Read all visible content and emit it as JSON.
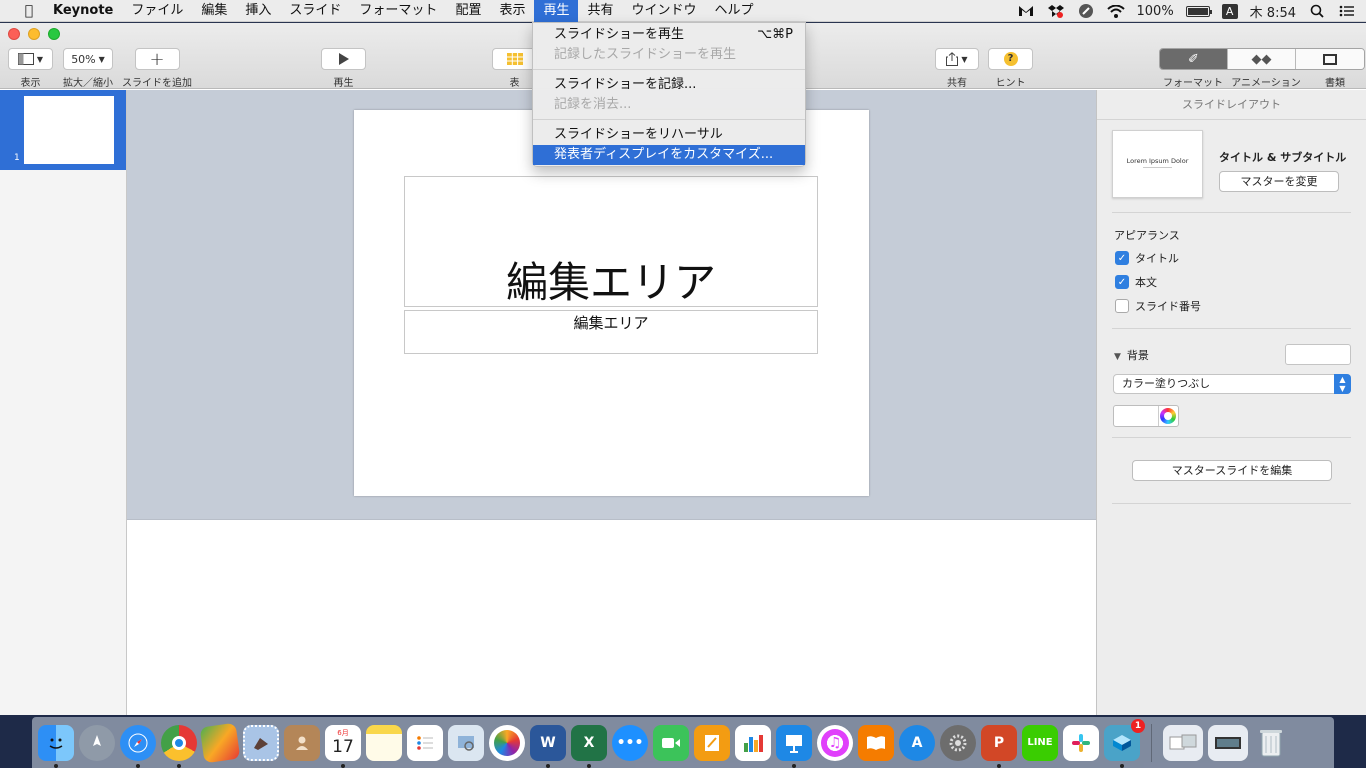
{
  "menubar": {
    "app": "Keynote",
    "items": [
      "ファイル",
      "編集",
      "挿入",
      "スライド",
      "フォーマット",
      "配置",
      "表示",
      "再生",
      "共有",
      "ウインドウ",
      "ヘルプ"
    ],
    "active": "再生",
    "battery": "100%",
    "ime": "A",
    "clock": "木 8:54"
  },
  "toolbar": {
    "view_label": "表示",
    "zoom_value": "50%",
    "zoom_label": "拡大／縮小",
    "add_slide_label": "スライドを追加",
    "play_label": "再生",
    "table_label": "表",
    "share_label": "共有",
    "hint_label": "ヒント",
    "format_label": "フォーマット",
    "animate_label": "アニメーション",
    "document_label": "書類"
  },
  "navigator": {
    "slide_number": "1"
  },
  "slide": {
    "title": "編集エリア",
    "subtitle": "編集エリア"
  },
  "inspector": {
    "header": "スライドレイアウト",
    "layout_preview_title": "Lorem Ipsum Dolor",
    "layout_name": "タイトル & サブタイトル",
    "change_master": "マスターを変更",
    "appearance": "アピアランス",
    "title_check": "タイトル",
    "body_check": "本文",
    "slide_number_check": "スライド番号",
    "background": "背景",
    "fill_type": "カラー塗りつぶし",
    "edit_master": "マスタースライドを編集"
  },
  "play_menu": {
    "play": "スライドショーを再生",
    "play_shortcut": "⌥⌘P",
    "play_recorded": "記録したスライドショーを再生",
    "record": "スライドショーを記録...",
    "clear_recording": "記録を消去...",
    "rehearse": "スライドショーをリハーサル",
    "customize_presenter": "発表者ディスプレイをカスタマイズ..."
  },
  "dock": {
    "calendar_month": "6月",
    "calendar_day": "17",
    "badge_count": "1"
  },
  "colors": {
    "accent": "#2f6fd6",
    "checkbox": "#2f7fe0",
    "canvas_bg": "#c5ccd7"
  }
}
